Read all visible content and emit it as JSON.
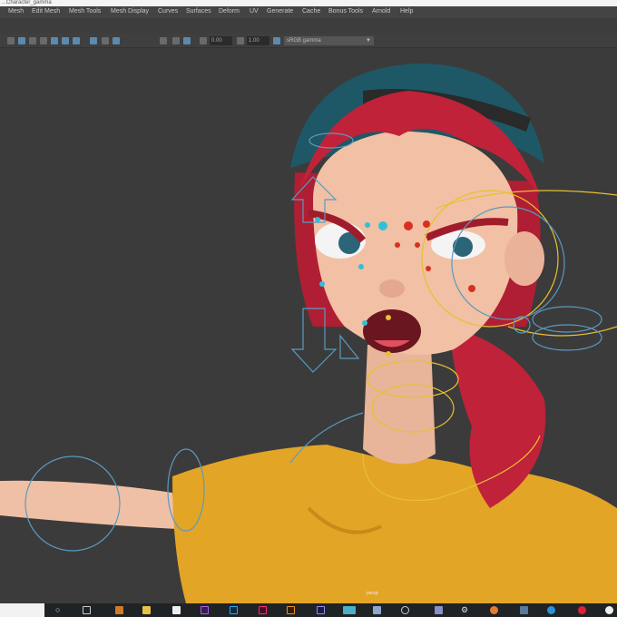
{
  "title_bar": {
    "text": "...Character_gamma"
  },
  "menu": [
    "Mesh",
    "Edit Mesh",
    "Mesh Tools",
    "Mesh Display",
    "Curves",
    "Surfaces",
    "Deform",
    "UV",
    "Generate",
    "Cache",
    "Bonus Tools",
    "Arnold",
    "Help"
  ],
  "toolbar": {
    "exposure_value": "0.00",
    "gamma_value": "1.00",
    "color_space": "sRGB gamma"
  },
  "viewport": {
    "camera_label": "persp"
  },
  "taskbar": {
    "apps": [
      "search",
      "task-view",
      "app",
      "file-explorer",
      "app",
      "premiere-pro",
      "photoshop",
      "indesign",
      "illustrator",
      "after-effects",
      "maya",
      "app",
      "app",
      "app",
      "settings",
      "app",
      "app",
      "edge",
      "opera",
      "app"
    ]
  },
  "colors": {
    "viewport_bg": "#3b3b3b",
    "hair": "#c0223a",
    "shirt": "#e4a825",
    "cap": "#1e5866",
    "rig_yellow": "#e8c030",
    "rig_blue": "#5a9ac0"
  }
}
